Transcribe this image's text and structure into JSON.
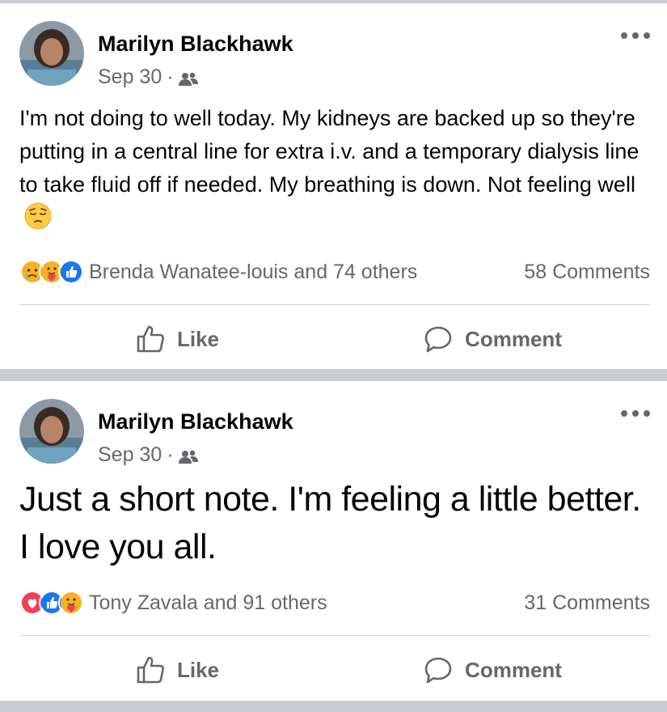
{
  "posts": [
    {
      "author": "Marilyn Blackhawk",
      "date": "Sep 30",
      "separator": "·",
      "audience_icon": "friends-icon",
      "text": "I'm not doing to well today. My kidneys are backed up so they're putting in a central line for extra i.v. and a temporary dialysis line to take fluid off if needed. My breathing is down. Not feeling well",
      "text_emoji": "pensive-face",
      "reactions": [
        "sad",
        "care",
        "like"
      ],
      "reaction_summary": "Brenda Wanatee-louis and 74 others",
      "comments": "58 Comments",
      "like_label": "Like",
      "comment_label": "Comment"
    },
    {
      "author": "Marilyn Blackhawk",
      "date": "Sep 30",
      "separator": "·",
      "audience_icon": "friends-icon",
      "text": "Just a short note. I'm feeling a little better. I love you all.",
      "reactions": [
        "love",
        "like",
        "care"
      ],
      "reaction_summary": "Tony Zavala and 91 others",
      "comments": "31 Comments",
      "like_label": "Like",
      "comment_label": "Comment"
    }
  ],
  "colors": {
    "feed_background": "#c9ccd1",
    "secondary_text": "#65676b",
    "like_blue": "#1877f2",
    "love_red": "#f33e58",
    "reaction_yellow": "#f7b125"
  }
}
